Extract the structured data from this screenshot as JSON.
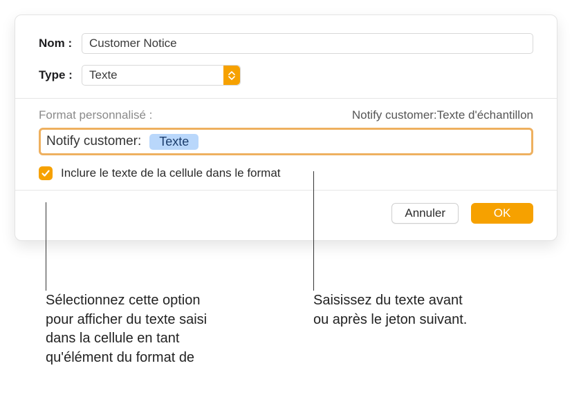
{
  "labels": {
    "name": "Nom :",
    "type": "Type :",
    "custom_format": "Format personnalisé :",
    "include_text": "Inclure le texte de la cellule dans le format"
  },
  "name_value": "Customer Notice",
  "type_value": "Texte",
  "preview": "Notify customer:Texte d'échantillon",
  "format_field": {
    "prefix": "Notify customer:",
    "token": "Texte"
  },
  "buttons": {
    "cancel": "Annuler",
    "ok": "OK"
  },
  "callouts": {
    "checkbox": "Sélectionnez cette option pour afficher du texte saisi dans la cellule en tant qu'élément du format de",
    "token": "Saisissez du texte avant ou après le jeton suivant."
  }
}
